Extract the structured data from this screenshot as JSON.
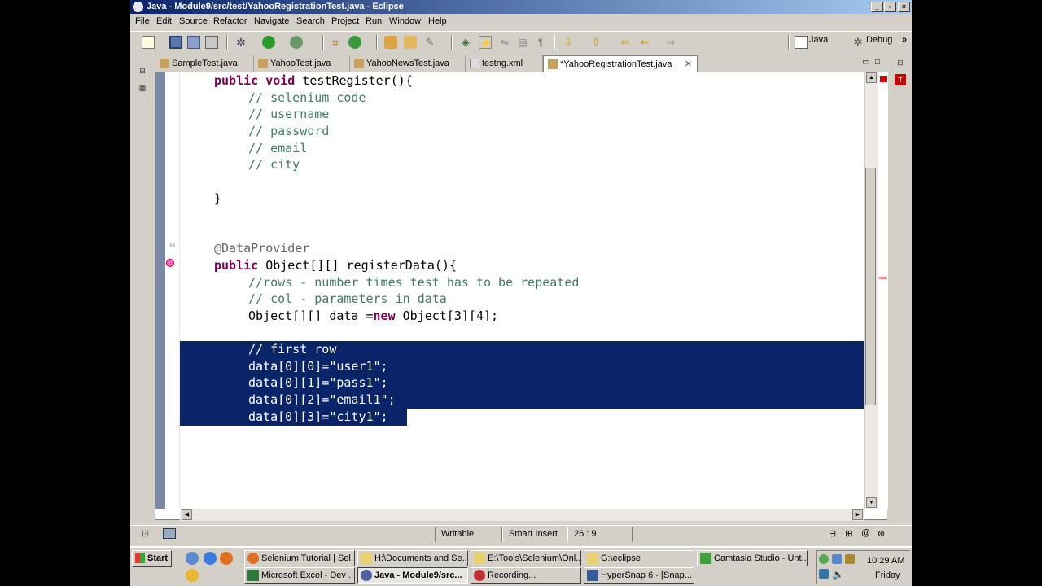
{
  "window": {
    "title": "Java - Module9/src/test/YahooRegistrationTest.java - Eclipse"
  },
  "menu": [
    "File",
    "Edit",
    "Source",
    "Refactor",
    "Navigate",
    "Search",
    "Project",
    "Run",
    "Window",
    "Help"
  ],
  "perspectives": {
    "java": "Java",
    "debug": "Debug"
  },
  "tabs": [
    {
      "label": "SampleTest.java"
    },
    {
      "label": "YahooTest.java"
    },
    {
      "label": "YahooNewsTest.java"
    },
    {
      "label": "testng.xml"
    },
    {
      "label": "*YahooRegistrationTest.java"
    }
  ],
  "code": {
    "l1": {
      "kw1": "public",
      "kw2": "void",
      "rest": " testRegister(){"
    },
    "l2": "// selenium code",
    "l3": "// username",
    "l4": "// password",
    "l5": "// email",
    "l6": "// city",
    "l7": "}",
    "l8": "@DataProvider",
    "l9": {
      "kw": "public",
      "rest": " Object[][] registerData(){"
    },
    "l10": "//rows - number times test has to be repeated",
    "l11": "// col - parameters in data",
    "l12": {
      "pre": "Object[][] data =",
      "kw": "new",
      "post": " Object[3][4];"
    },
    "l13": "// first row",
    "l14": "data[0][0]=\"user1\";",
    "l15": "data[0][1]=\"pass1\";",
    "l16": "data[0][2]=\"email1\";",
    "l17": "data[0][3]=\"city1\";"
  },
  "status": {
    "mode": "Writable",
    "insert": "Smart Insert",
    "position": "26 : 9"
  },
  "taskbar": {
    "start": "Start",
    "row1": [
      "Selenium Tutorial | Sel...",
      "H:\\Documents and Se...",
      "E:\\Tools\\Selenium\\Onl...",
      "G:\\eclipse",
      "Camtasia Studio - Unt..."
    ],
    "row2": [
      "Microsoft Excel - Dev ...",
      "Java - Module9/src...",
      "Recording...",
      "HyperSnap 6 - [Snap..."
    ],
    "clock": {
      "time": "10:29 AM",
      "day": "Friday"
    }
  }
}
